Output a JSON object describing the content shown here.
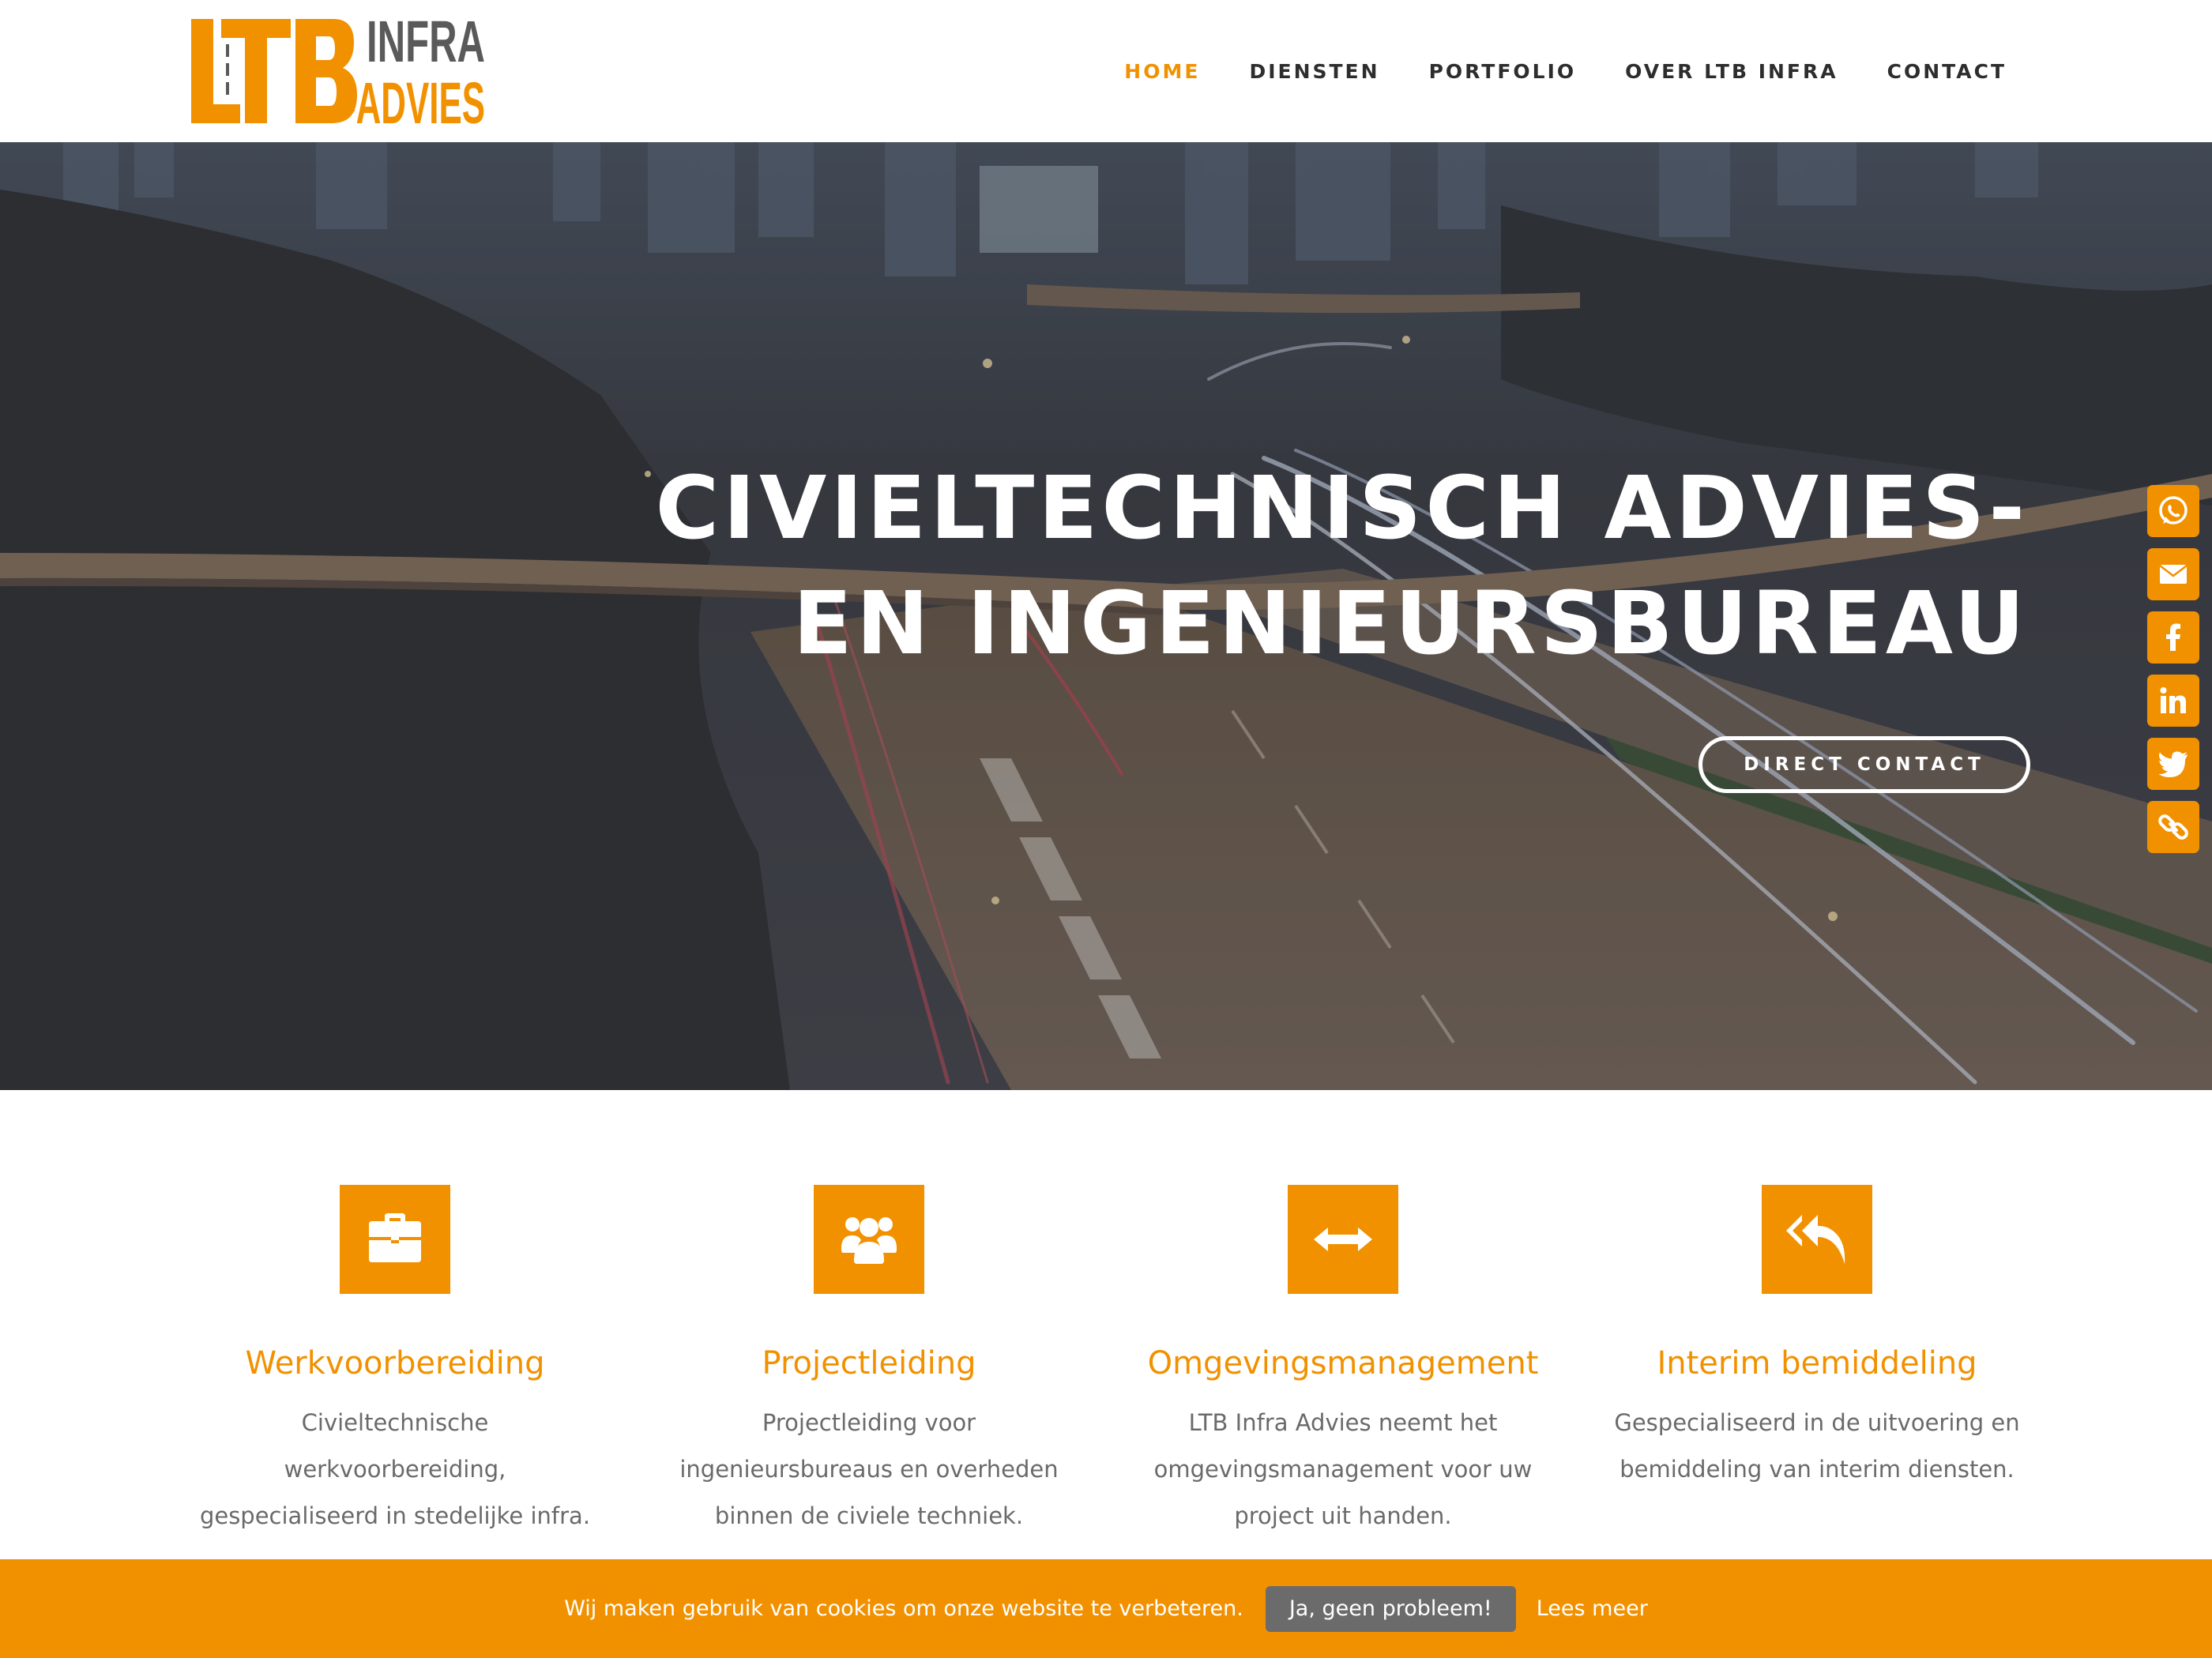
{
  "brand": {
    "logo_letters": "LTB",
    "logo_line1": "INFRA",
    "logo_line2": "-ADVIES",
    "accent_color": "#f29100",
    "logo_gray": "#5a5a5a"
  },
  "nav": {
    "items": [
      {
        "label": "HOME",
        "active": true
      },
      {
        "label": "DIENSTEN",
        "active": false
      },
      {
        "label": "PORTFOLIO",
        "active": false
      },
      {
        "label": "OVER LTB INFRA",
        "active": false
      },
      {
        "label": "CONTACT",
        "active": false
      }
    ]
  },
  "hero": {
    "title_line1": "CIVIELTECHNISCH ADVIES-",
    "title_line2": "EN INGENIEURSBUREAU",
    "cta_label": "DIRECT CONTACT"
  },
  "share": {
    "buttons": [
      {
        "icon": "whatsapp-icon"
      },
      {
        "icon": "email-icon"
      },
      {
        "icon": "facebook-icon"
      },
      {
        "icon": "linkedin-icon"
      },
      {
        "icon": "twitter-icon"
      },
      {
        "icon": "link-icon"
      }
    ]
  },
  "features": [
    {
      "icon": "briefcase-icon",
      "title": "Werkvoorbereiding",
      "lines": [
        "Civieltechnische",
        "werkvoorbereiding,",
        "gespecialiseerd in stedelijke infra."
      ]
    },
    {
      "icon": "users-icon",
      "title": "Projectleiding",
      "lines": [
        "Projectleiding voor",
        "ingenieursbureaus en overheden",
        "binnen de civiele techniek."
      ]
    },
    {
      "icon": "arrows-horizontal-icon",
      "title": "Omgevingsmanagement",
      "lines": [
        "LTB Infra Advies neemt het",
        "omgevingsmanagement voor uw",
        "project uit handen."
      ]
    },
    {
      "icon": "reply-all-icon",
      "title": "Interim bemiddeling",
      "lines": [
        "Gespecialiseerd in de uitvoering en",
        "bemiddeling van interim diensten."
      ]
    }
  ],
  "cookie": {
    "text": "Wij maken gebruik van cookies om onze website te verbeteren.",
    "accept_label": "Ja, geen probleem!",
    "more_label": "Lees meer"
  }
}
